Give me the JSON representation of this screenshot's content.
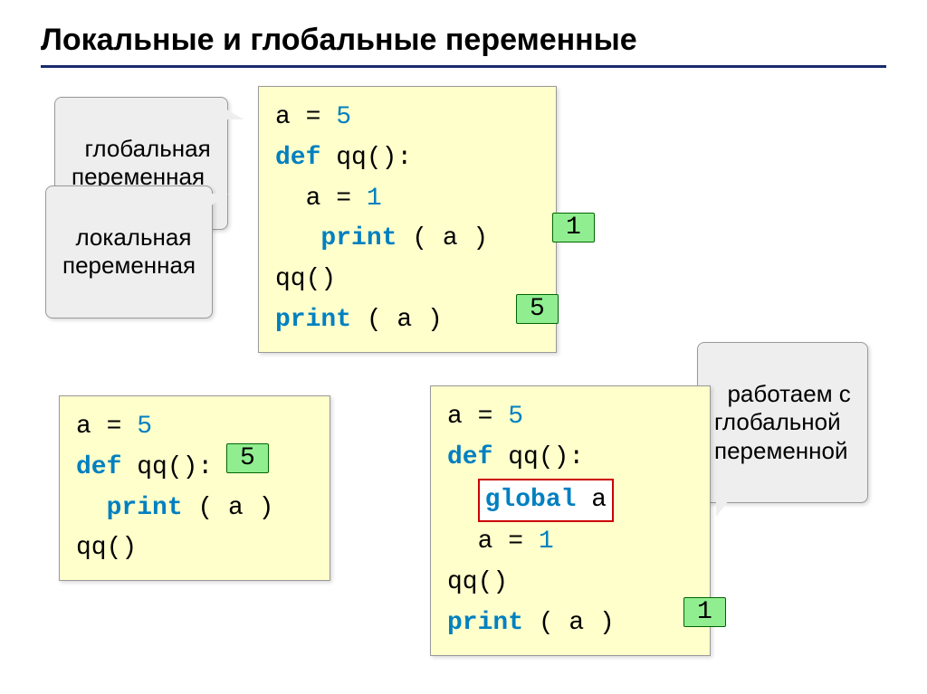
{
  "title": "Локальные и глобальные переменные",
  "callouts": {
    "global_var": "глобальная\nпеременная",
    "local_var": "локальная\nпеременная",
    "work_global": "работаем с\nглобальной\nпеременной"
  },
  "code1": {
    "l1a": "a",
    "l1b": "=",
    "l1c": "5",
    "l2a": "def",
    "l2b": " qq():",
    "l3": "  a",
    "l3b": "=",
    "l3c": "1",
    "l4a": "   print",
    "l4b": " ( a )",
    "l5": "qq()",
    "l6a": "print",
    "l6b": " ( a )"
  },
  "results1": {
    "r1": "1",
    "r2": "5"
  },
  "code2": {
    "l1a": "a",
    "l1b": "=",
    "l1c": "5",
    "l2a": "def",
    "l2b": " qq():",
    "l3a": "  print",
    "l3b": " ( a )",
    "l4": "qq()"
  },
  "results2": {
    "r1": "5"
  },
  "code3": {
    "l1a": "a",
    "l1b": "=",
    "l1c": "5",
    "l2a": "def",
    "l2b": " qq():",
    "l3a": "global",
    "l3b": " a",
    "l4a": "  a",
    "l4b": "=",
    "l4c": "1",
    "l5": "qq()",
    "l6a": "print",
    "l6b": " ( a )"
  },
  "results3": {
    "r1": "1"
  }
}
